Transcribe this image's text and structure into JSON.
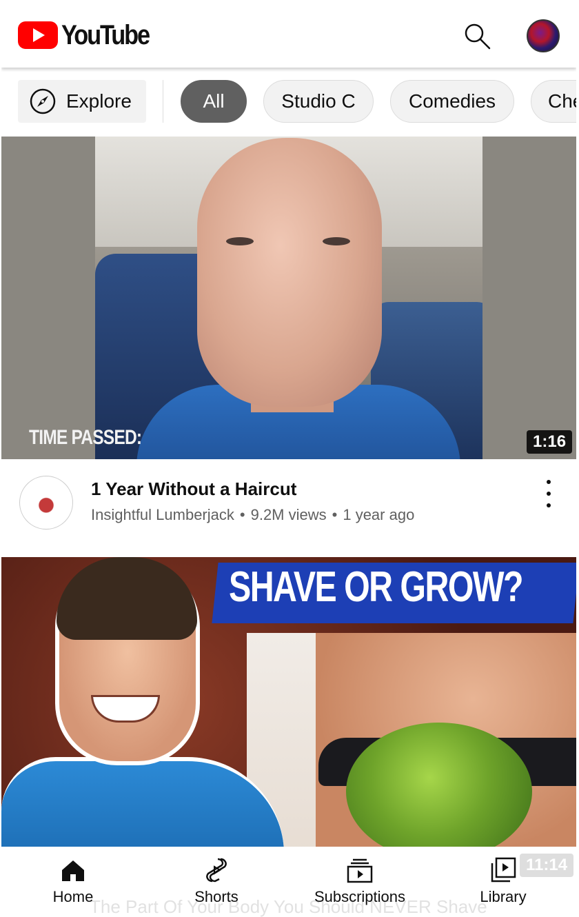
{
  "header": {
    "logo_text": "YouTube",
    "search_icon": "search-icon",
    "avatar_icon": "account-avatar"
  },
  "chips": {
    "explore_label": "Explore",
    "items": [
      {
        "label": "All",
        "active": true
      },
      {
        "label": "Studio C",
        "active": false
      },
      {
        "label": "Comedies",
        "active": false
      },
      {
        "label": "Che",
        "active": false
      }
    ]
  },
  "videos": [
    {
      "thumbnail_caption": "TIME PASSED:",
      "duration": "1:16",
      "title": "1 Year Without a Haircut",
      "channel": "Insightful Lumberjack",
      "views": "9.2M views",
      "age": "1 year ago"
    },
    {
      "thumbnail_caption": "SHAVE OR GROW?",
      "duration": "11:14",
      "title": "The Part Of Your Body You Should NEVER Shave"
    }
  ],
  "bottom_nav": [
    {
      "label": "Home",
      "icon": "home-icon"
    },
    {
      "label": "Shorts",
      "icon": "shorts-icon"
    },
    {
      "label": "Subscriptions",
      "icon": "subscriptions-icon"
    },
    {
      "label": "Library",
      "icon": "library-icon"
    }
  ],
  "colors": {
    "brand_red": "#ff0000",
    "chip_active": "#606060",
    "chip_bg": "#f2f2f2",
    "secondary_text": "#606060"
  }
}
